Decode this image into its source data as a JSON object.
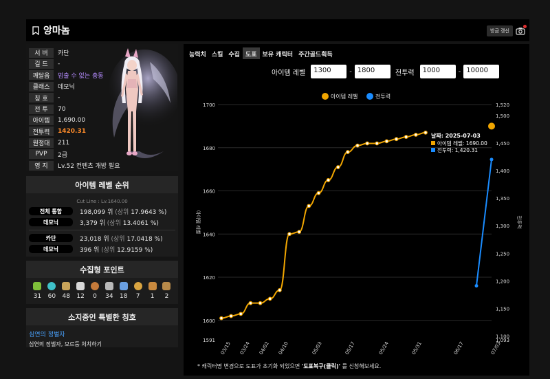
{
  "header": {
    "name": "앙마놈",
    "refresh_label": "방금 갱신"
  },
  "profile": {
    "rows": [
      {
        "key": "서 버",
        "value": "카단",
        "style": ""
      },
      {
        "key": "길 드",
        "value": "-",
        "style": ""
      },
      {
        "key": "깨달음",
        "value": "멈출 수 없는 충동",
        "style": "purple"
      },
      {
        "key": "클래스",
        "value": "데모닉",
        "style": ""
      },
      {
        "key": "칭 호",
        "value": "-",
        "style": ""
      },
      {
        "key": "전 투",
        "value": "70",
        "style": ""
      },
      {
        "key": "아이템",
        "value": "1,690.00",
        "style": ""
      },
      {
        "key": "전투력",
        "value": "1420.31",
        "style": "orange"
      },
      {
        "key": "원정대",
        "value": "211",
        "style": ""
      },
      {
        "key": "PVP",
        "value": "2급",
        "style": ""
      },
      {
        "key": "영 지",
        "value": "Lv.52 컨텐츠 개방 필요",
        "style": ""
      }
    ]
  },
  "ranking": {
    "title": "아이템 레벨 순위",
    "cutline": "Cut Line : Lv.1640.00",
    "rows": [
      {
        "label": "전체 통합",
        "rank": "198,099 위",
        "pct": "(상위",
        "pct_val": "17.9643 %)"
      },
      {
        "label": "데모닉",
        "rank": "3,379 위",
        "pct": "(상위",
        "pct_val": "13.4061 %)"
      },
      {
        "label": "카단",
        "rank": "23,018 위",
        "pct": "(상위",
        "pct_val": "17.0418 %)"
      },
      {
        "label": "데모닉",
        "rank": "396 위",
        "pct": "(상위",
        "pct_val": "12.9159 %)"
      }
    ]
  },
  "collect": {
    "title": "수집형 포인트",
    "items": [
      {
        "icon": "mokoko-seed-icon",
        "value": "31",
        "color": "#7fbf3a"
      },
      {
        "icon": "island-heart-icon",
        "value": "60",
        "color": "#3fc1c9"
      },
      {
        "icon": "great-art-icon",
        "value": "48",
        "color": "#c9a45a"
      },
      {
        "icon": "giant-heart-icon",
        "value": "12",
        "color": "#d8d8d8"
      },
      {
        "icon": "ignea-token-icon",
        "value": "0",
        "color": "#c47a3a"
      },
      {
        "icon": "orpheus-star-icon",
        "value": "34",
        "color": "#b9b9b9"
      },
      {
        "icon": "sea-bounty-icon",
        "value": "18",
        "color": "#6a9fe0"
      },
      {
        "icon": "world-tree-leaf-icon",
        "value": "7",
        "color": "#d9a441"
      },
      {
        "icon": "omnium-star-icon",
        "value": "1",
        "color": "#c98a3f"
      },
      {
        "icon": "masterpiece-icon",
        "value": "2",
        "color": "#b88a4a"
      }
    ]
  },
  "titles": {
    "title": "소지중인 특별한 칭호",
    "name": "심연의 정벌자",
    "desc": "심연의 정벌자, 모르둠 처치하기"
  },
  "tabs": [
    {
      "label": "능력치",
      "active": false
    },
    {
      "label": "스킬",
      "active": false
    },
    {
      "label": "수집",
      "active": false
    },
    {
      "label": "도표",
      "active": true
    },
    {
      "label": "보유 캐릭터",
      "active": false
    },
    {
      "label": "주간골드획득",
      "active": false
    }
  ],
  "filters": {
    "item_label": "아이템 레벨",
    "item_min": "1300",
    "item_max": "1800",
    "power_label": "전투력",
    "power_min": "1000",
    "power_max": "10000"
  },
  "note": {
    "prefix": "* 캐릭터명 변경으로 도표가 초기화 되었으면",
    "highlight": "'도표복구(클릭)'",
    "suffix": "를 신청해보세요."
  },
  "chart_data": {
    "type": "line",
    "x": [
      "03/15",
      "03/19",
      "03/22",
      "03/26",
      "03/29",
      "04/02",
      "04/06",
      "04/09",
      "04/13",
      "04/16",
      "04/20",
      "04/23",
      "04/27",
      "04/30",
      "05/04",
      "05/07",
      "05/11",
      "05/14",
      "05/18",
      "05/21",
      "05/25",
      "06/01"
    ],
    "x_tick_labels": [
      "03/15",
      "03/24",
      "04/02",
      "04/10",
      "05/03",
      "05/17",
      "05/24",
      "05/31",
      "06/17",
      "07/03"
    ],
    "series": [
      {
        "name": "아이템 레벨",
        "axis": "left",
        "color": "#f0a500",
        "values": [
          1601,
          1602,
          1603,
          1608,
          1608,
          1610,
          1614,
          1640,
          1641,
          1653,
          1659,
          1665,
          1671,
          1678,
          1681,
          1682,
          1682,
          1683,
          1684,
          1685,
          1686,
          1687
        ]
      },
      {
        "name": "전투력",
        "axis": "right",
        "color": "#1a8cff",
        "points": [
          {
            "x": "06/17",
            "y": 1191
          },
          {
            "x": "07/03",
            "y": 1420.31
          }
        ]
      }
    ],
    "item_point_last": {
      "x": "07/03",
      "y": 1690
    },
    "left_ticks": [
      1700,
      1680,
      1660,
      1640,
      1620,
      1600,
      1591
    ],
    "left_ylim": [
      1591,
      1700
    ],
    "left_ylabel": "아이템 레벨",
    "right_ticks": [
      1520,
      1500,
      1450,
      1400,
      1350,
      1300,
      1250,
      1200,
      1150,
      1100,
      1093
    ],
    "right_ylim": [
      1093,
      1520
    ],
    "right_ylabel": "전투력",
    "tooltip": {
      "date": "날짜: 2025-07-03",
      "item": "아이템 레벨: 1690.00",
      "power": "전투력: 1,420.31"
    }
  }
}
